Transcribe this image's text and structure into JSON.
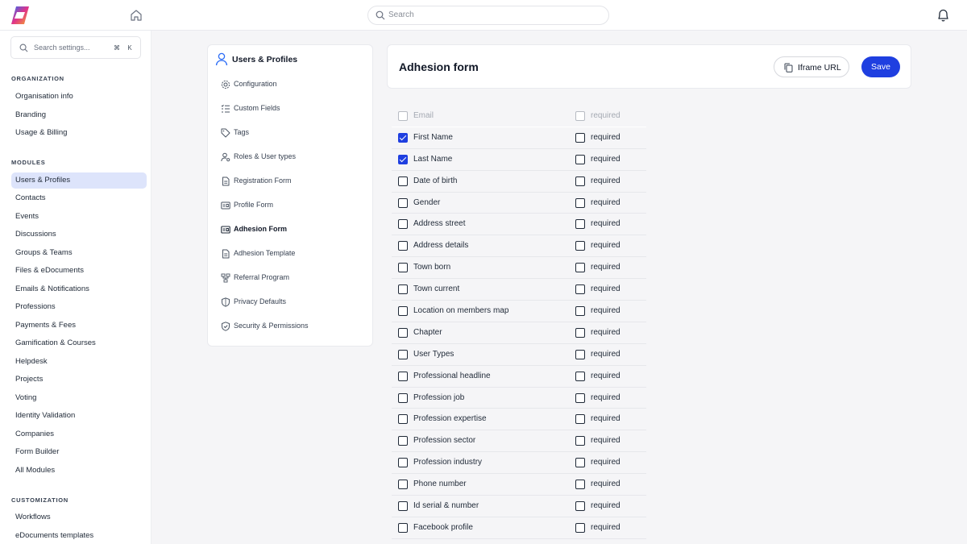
{
  "topbar": {
    "search_placeholder": "Search"
  },
  "sidebar": {
    "search_placeholder": "Search settings...",
    "shortcut": [
      "⌘",
      "K"
    ],
    "sections": [
      {
        "title": "ORGANIZATION",
        "items": [
          "Organisation info",
          "Branding",
          "Usage & Billing"
        ]
      },
      {
        "title": "MODULES",
        "items": [
          "Users & Profiles",
          "Contacts",
          "Events",
          "Discussions",
          "Groups & Teams",
          "Files & eDocuments",
          "Emails & Notifications",
          "Professions",
          "Payments & Fees",
          "Gamification & Courses",
          "Helpdesk",
          "Projects",
          "Voting",
          "Identity Validation",
          "Companies",
          "Form Builder",
          "All Modules"
        ]
      },
      {
        "title": "CUSTOMIZATION",
        "items": [
          "Workflows",
          "eDocuments templates"
        ]
      }
    ],
    "active_item": "Users & Profiles"
  },
  "menu": {
    "title": "Users & Profiles",
    "items": [
      {
        "label": "Configuration",
        "icon": "gear-icon"
      },
      {
        "label": "Custom Fields",
        "icon": "list-icon"
      },
      {
        "label": "Tags",
        "icon": "tag-icon"
      },
      {
        "label": "Roles & User types",
        "icon": "user-cog-icon"
      },
      {
        "label": "Registration Form",
        "icon": "document-icon"
      },
      {
        "label": "Profile Form",
        "icon": "id-card-icon"
      },
      {
        "label": "Adhesion Form",
        "icon": "id-card-icon"
      },
      {
        "label": "Adhesion Template",
        "icon": "document-icon"
      },
      {
        "label": "Referral Program",
        "icon": "network-icon"
      },
      {
        "label": "Privacy Defaults",
        "icon": "shield-icon"
      },
      {
        "label": "Security & Permissions",
        "icon": "shield-check-icon"
      }
    ],
    "active_item": "Adhesion Form"
  },
  "header": {
    "title": "Adhesion form",
    "iframe_label": "Iframe URL",
    "save_label": "Save"
  },
  "fields": [
    {
      "label": "Email",
      "checked": false,
      "required": false,
      "disabled": true,
      "required_label": "required"
    },
    {
      "label": "First Name",
      "checked": true,
      "required": false,
      "disabled": false,
      "required_label": "required"
    },
    {
      "label": "Last Name",
      "checked": true,
      "required": false,
      "disabled": false,
      "required_label": "required"
    },
    {
      "label": "Date of birth",
      "checked": false,
      "required": false,
      "disabled": false,
      "required_label": "required"
    },
    {
      "label": "Gender",
      "checked": false,
      "required": false,
      "disabled": false,
      "required_label": "required"
    },
    {
      "label": "Address street",
      "checked": false,
      "required": false,
      "disabled": false,
      "required_label": "required"
    },
    {
      "label": "Address details",
      "checked": false,
      "required": false,
      "disabled": false,
      "required_label": "required"
    },
    {
      "label": "Town born",
      "checked": false,
      "required": false,
      "disabled": false,
      "required_label": "required"
    },
    {
      "label": "Town current",
      "checked": false,
      "required": false,
      "disabled": false,
      "required_label": "required"
    },
    {
      "label": "Location on members map",
      "checked": false,
      "required": false,
      "disabled": false,
      "required_label": "required"
    },
    {
      "label": "Chapter",
      "checked": false,
      "required": false,
      "disabled": false,
      "required_label": "required"
    },
    {
      "label": "User Types",
      "checked": false,
      "required": false,
      "disabled": false,
      "required_label": "required"
    },
    {
      "label": "Professional headline",
      "checked": false,
      "required": false,
      "disabled": false,
      "required_label": "required"
    },
    {
      "label": "Profession job",
      "checked": false,
      "required": false,
      "disabled": false,
      "required_label": "required"
    },
    {
      "label": "Profession expertise",
      "checked": false,
      "required": false,
      "disabled": false,
      "required_label": "required"
    },
    {
      "label": "Profession sector",
      "checked": false,
      "required": false,
      "disabled": false,
      "required_label": "required"
    },
    {
      "label": "Profession industry",
      "checked": false,
      "required": false,
      "disabled": false,
      "required_label": "required"
    },
    {
      "label": "Phone number",
      "checked": false,
      "required": false,
      "disabled": false,
      "required_label": "required"
    },
    {
      "label": "Id serial & number",
      "checked": false,
      "required": false,
      "disabled": false,
      "required_label": "required"
    },
    {
      "label": "Facebook profile",
      "checked": false,
      "required": false,
      "disabled": false,
      "required_label": "required"
    }
  ],
  "colors": {
    "accent": "#1f3fe0",
    "active_nav_bg": "#dde4fb"
  }
}
